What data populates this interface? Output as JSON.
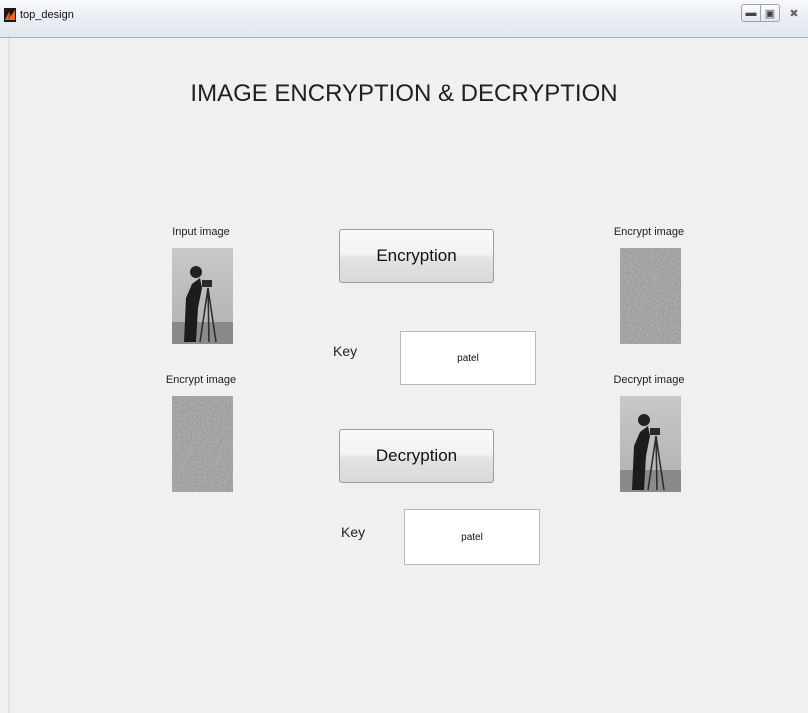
{
  "window": {
    "title": "top_design",
    "icon": "matlab-logo-icon",
    "controls": {
      "minimize": "minimize-icon",
      "maximize": "maximize-icon",
      "close": "close-icon"
    }
  },
  "main": {
    "heading": "IMAGE ENCRYPTION & DECRYPTION",
    "left_panel": {
      "input_label": "Input image",
      "encrypt_label": "Encrypt image"
    },
    "right_panel": {
      "encrypt_label": "Encrypt image",
      "decrypt_label": "Decrypt image"
    },
    "encryption": {
      "button_label": "Encryption",
      "key_label": "Key",
      "key_value": "patel"
    },
    "decryption": {
      "button_label": "Decryption",
      "key_label": "Key",
      "key_value": "patel"
    }
  }
}
